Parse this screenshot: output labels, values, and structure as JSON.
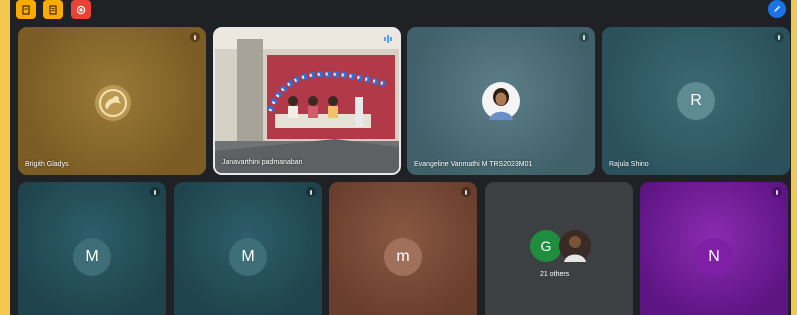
{
  "toolbar": {
    "icons": [
      "notes-icon",
      "document-icon",
      "record-icon",
      "edit-pen-icon"
    ],
    "colors": {
      "yellow": "#f9ab00",
      "red": "#ea4335",
      "blue": "#1a73e8"
    }
  },
  "participants": [
    {
      "name": "Brigith Gladys",
      "avatar": "emblem-avatar",
      "tile_color": "#8a6a2c"
    },
    {
      "name": "Janavarthini padmanaban",
      "avatar": "video-stage-feed",
      "speaking": true
    },
    {
      "name": "Evangeline Vanmathi M TRS2023M01",
      "avatar": "profile-photo",
      "tile_color": "#4a6a74"
    },
    {
      "name": "Rajula Shino",
      "initial": "R",
      "tile_color": "#2f5864"
    },
    {
      "initial": "M",
      "tile_color": "#234b55"
    },
    {
      "initial": "M",
      "tile_color": "#234b55"
    },
    {
      "initial": "m",
      "tile_color": "#7a4a36"
    },
    {
      "initial": "N",
      "tile_color": "#6a1b9a"
    }
  ],
  "others_tile": {
    "initial": "G",
    "label": "21 others"
  }
}
